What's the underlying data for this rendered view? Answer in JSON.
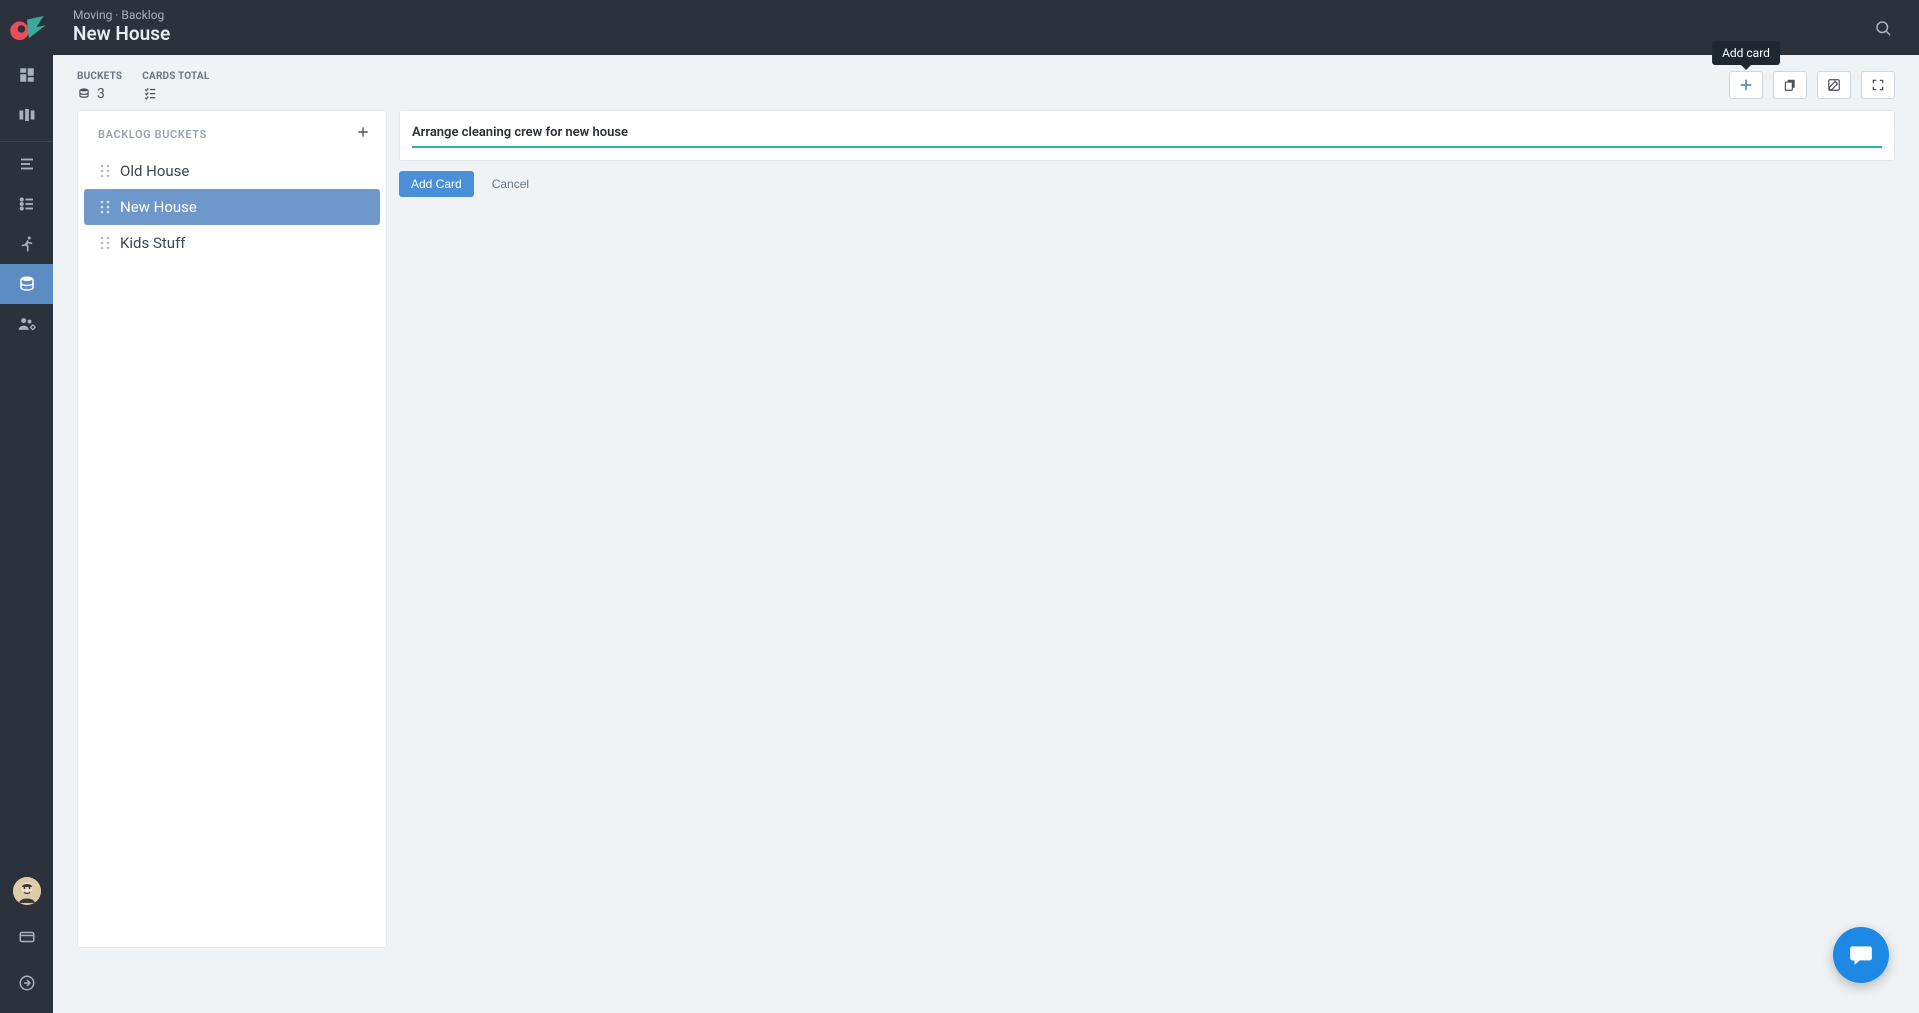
{
  "header": {
    "breadcrumb": "Moving · Backlog",
    "title": "New House",
    "tooltip_add_card": "Add card"
  },
  "stats": {
    "buckets_label": "BUCKETS",
    "buckets_count": "3",
    "cards_label": "CARDS TOTAL"
  },
  "sidebar": {
    "section_label": "BACKLOG BUCKETS",
    "items": [
      {
        "label": "Old House",
        "selected": false
      },
      {
        "label": "New House",
        "selected": true
      },
      {
        "label": "Kids Stuff",
        "selected": false
      }
    ]
  },
  "card_form": {
    "input_value": "Arrange cleaning crew for new house",
    "add_label": "Add Card",
    "cancel_label": "Cancel"
  },
  "icons": {
    "search": "search-icon",
    "plus": "plus-icon",
    "copy": "copy-icon",
    "edit": "edit-icon",
    "fullscreen": "fullscreen-icon",
    "db": "database-icon",
    "checklist": "checklist-icon"
  },
  "colors": {
    "header_bg": "#2b323b",
    "accent_blue": "#5b8cc4",
    "button_blue": "#4a90d9",
    "teal_underline": "#29b49c",
    "fab_blue": "#1e88e5"
  }
}
